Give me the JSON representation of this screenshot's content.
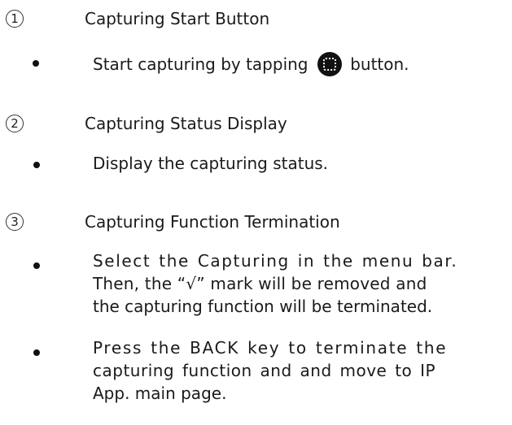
{
  "sections": [
    {
      "number": "1",
      "title": "Capturing Start Button",
      "bullets": [
        {
          "text_before": "Start capturing by tapping",
          "icon": "capture-button-icon",
          "text_after": "button."
        }
      ]
    },
    {
      "number": "2",
      "title": "Capturing Status Display",
      "bullets": [
        {
          "lines": [
            "Display the capturing status."
          ]
        }
      ]
    },
    {
      "number": "3",
      "title": "Capturing Function Termination",
      "bullets": [
        {
          "lines": [
            "Select the Capturing in the menu bar.",
            "Then, the “√” mark will be removed and",
            "the capturing function will be terminated."
          ]
        },
        {
          "lines": [
            "Press the BACK key to terminate the",
            "capturing function and and move to IP",
            "App. main page."
          ]
        }
      ]
    }
  ],
  "colors": {
    "text": "#1a1a1a",
    "background": "#ffffff",
    "icon_fill": "#111111"
  }
}
